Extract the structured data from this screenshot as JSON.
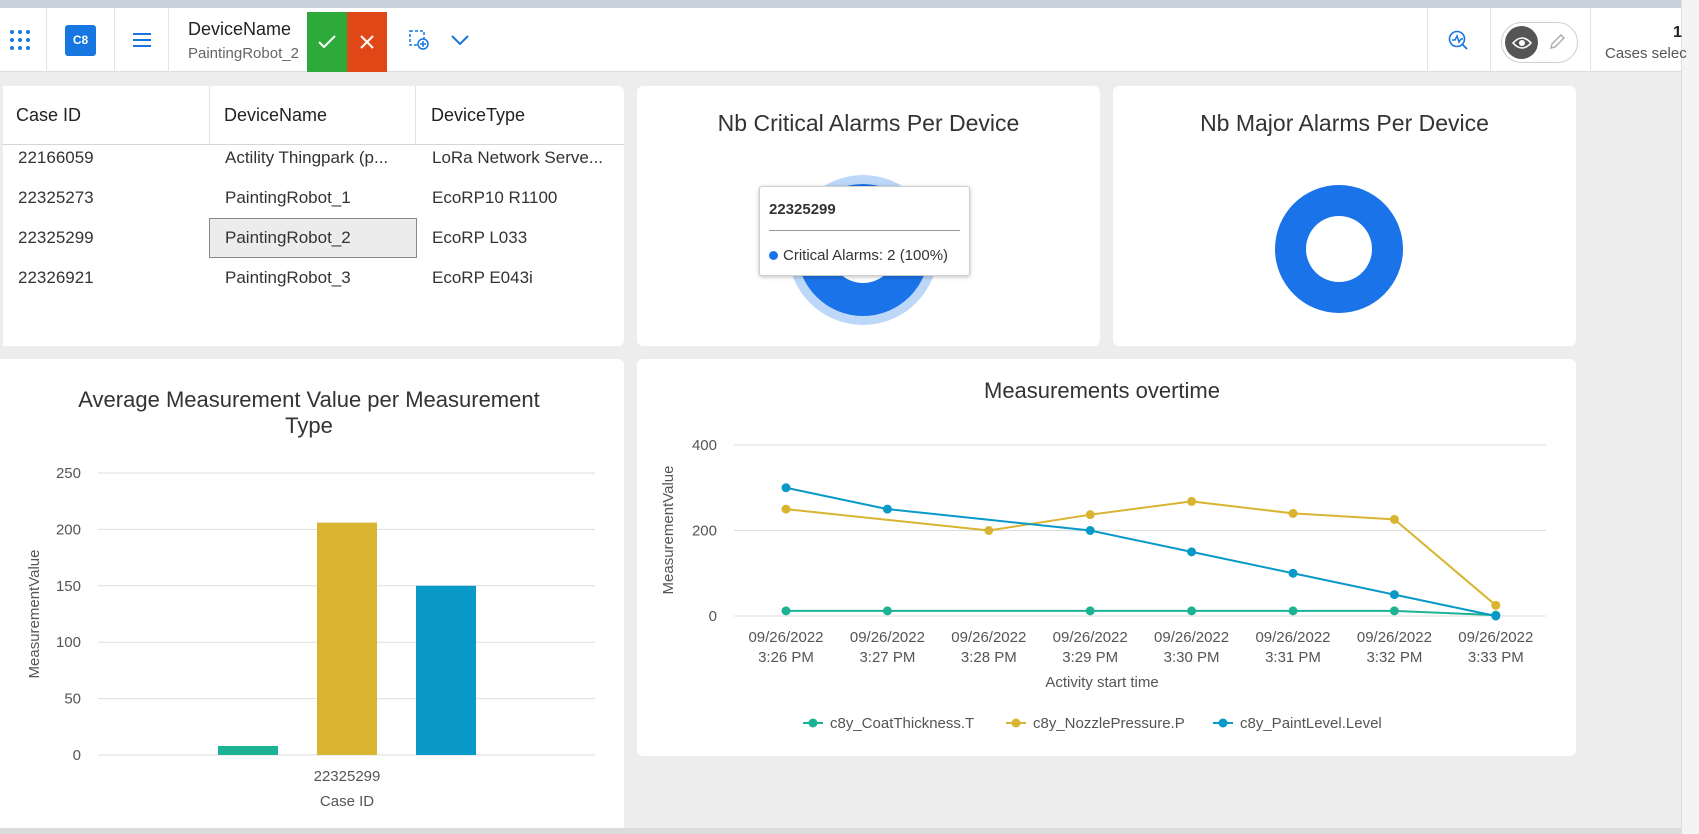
{
  "header": {
    "app_badge": "C8",
    "device_label": "DeviceName",
    "device_value": "PaintingRobot_2",
    "cases_count": "1",
    "cases_label": "Cases selec"
  },
  "table": {
    "columns": [
      "Case ID",
      "DeviceName",
      "DeviceType"
    ],
    "rows": [
      [
        "22166059",
        "Actility Thingpark (p...",
        "LoRa Network Serve..."
      ],
      [
        "22325273",
        "PaintingRobot_1",
        "EcoRP10 R1100"
      ],
      [
        "22325299",
        "PaintingRobot_2",
        "EcoRP L033"
      ],
      [
        "22326921",
        "PaintingRobot_3",
        "EcoRP E043i"
      ]
    ],
    "selected_row": 2
  },
  "critical_panel": {
    "title": "Nb Critical Alarms Per Device",
    "tooltip_title": "22325299",
    "tooltip_text": "Critical Alarms: 2 (100%)"
  },
  "major_panel": {
    "title": "Nb Major Alarms Per Device"
  },
  "colors": {
    "green": "#1bb394",
    "gold": "#d9b430",
    "blue": "#0899c9",
    "donut": "#1a73e8",
    "accept": "#2eaa3a",
    "reject": "#e04716"
  },
  "chart_data": [
    {
      "type": "pie",
      "title": "Nb Critical Alarms Per Device",
      "slices": [
        {
          "label": "22325299",
          "value": 2,
          "percent": 100
        }
      ],
      "donut": true
    },
    {
      "type": "pie",
      "title": "Nb Major Alarms Per Device",
      "slices": [
        {
          "label": "",
          "value": 1,
          "percent": 100
        }
      ],
      "donut": true
    },
    {
      "type": "bar",
      "title": "Average Measurement Value per Measurement Type",
      "xlabel": "Case ID",
      "ylabel": "MeasurementValue",
      "categories": [
        "22325299"
      ],
      "series": [
        {
          "values": [
            8
          ],
          "color": "#1bb394"
        },
        {
          "values": [
            206
          ],
          "color": "#d9b430"
        },
        {
          "values": [
            150
          ],
          "color": "#0899c9"
        }
      ],
      "ylim": [
        0,
        250
      ],
      "yticks": [
        0,
        50,
        100,
        150,
        200,
        250
      ],
      "grid": true
    },
    {
      "type": "line",
      "title": "Measurements overtime",
      "xlabel": "Activity start time",
      "ylabel": "MeasurementValue",
      "x": [
        [
          "09/26/2022",
          "3:26 PM"
        ],
        [
          "09/26/2022",
          "3:27 PM"
        ],
        [
          "09/26/2022",
          "3:28 PM"
        ],
        [
          "09/26/2022",
          "3:29 PM"
        ],
        [
          "09/26/2022",
          "3:30 PM"
        ],
        [
          "09/26/2022",
          "3:31 PM"
        ],
        [
          "09/26/2022",
          "3:32 PM"
        ],
        [
          "09/26/2022",
          "3:33 PM"
        ]
      ],
      "series": [
        {
          "name": "c8y_CoatThickness.T",
          "color": "#1bb394",
          "values": [
            12,
            12,
            null,
            12,
            12,
            12,
            12,
            2
          ]
        },
        {
          "name": "c8y_NozzlePressure.P",
          "color": "#d9b430",
          "values": [
            250,
            null,
            200,
            237,
            268,
            240,
            226,
            25
          ]
        },
        {
          "name": "c8y_PaintLevel.Level",
          "color": "#0899c9",
          "values": [
            300,
            250,
            null,
            200,
            150,
            100,
            50,
            0
          ]
        }
      ],
      "ylim": [
        0,
        400
      ],
      "yticks": [
        0,
        200,
        400
      ],
      "grid": true,
      "legend": "bottom"
    }
  ]
}
